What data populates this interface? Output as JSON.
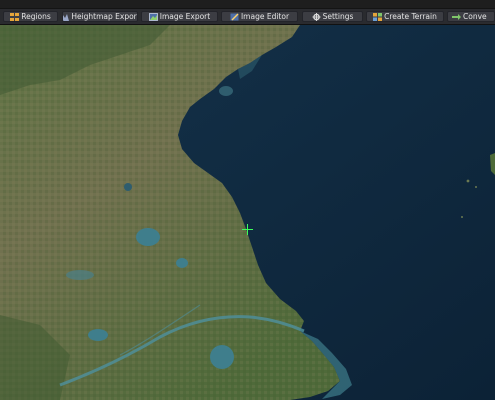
{
  "toolbar": {
    "buttons": [
      {
        "label": "Regions",
        "icon": "grid-icon"
      },
      {
        "label": "Heightmap Export",
        "icon": "terrain-export-icon"
      },
      {
        "label": "Image Export",
        "icon": "image-export-icon"
      },
      {
        "label": "Image Editor",
        "icon": "image-edit-icon"
      },
      {
        "label": "Settings",
        "icon": "gear-icon"
      },
      {
        "label": "Create Terrain",
        "icon": "create-terrain-icon"
      },
      {
        "label": "Conve",
        "icon": "convert-icon"
      }
    ]
  },
  "map": {
    "view": "satellite",
    "colors": {
      "sea": "#0f2a3f",
      "land_green": "#4d6a38",
      "land_tan": "#7e7a55",
      "lake": "#3f7e8c",
      "crosshair": "#3cff5a"
    }
  }
}
